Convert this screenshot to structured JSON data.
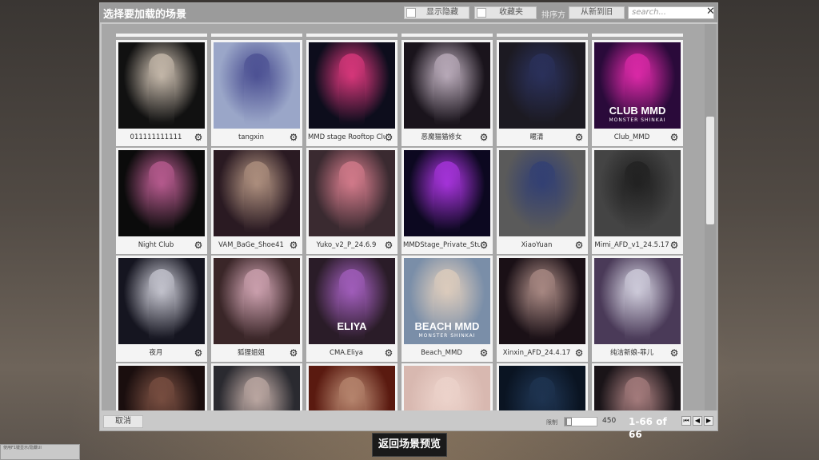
{
  "dialog": {
    "title": "选择要加载的场景",
    "show_hidden_label": "显示隐藏",
    "favorites_label": "收藏夹",
    "sort_label": "排序方",
    "sort_value": "从新到旧",
    "search_placeholder": "search...",
    "close_symbol": "✕"
  },
  "tiles": [
    {
      "label": "011111111111",
      "bg": "#111111",
      "accent": "#e8d9c8"
    },
    {
      "label": "tangxin",
      "bg": "#9aa6c8",
      "accent": "#3c3f88"
    },
    {
      "label": "MMD stage Rooftop Club",
      "bg": "#0d0d1c",
      "accent": "#ff3f8d",
      "overlay": ""
    },
    {
      "label": "恶魔猫猫修女",
      "bg": "#1a141c",
      "accent": "#d8c8d8"
    },
    {
      "label": "暱清",
      "bg": "#1c1a22",
      "accent": "#2d3566"
    },
    {
      "label": "Club_MMD",
      "bg": "#2a0a3a",
      "accent": "#ff2fbd",
      "overlay": "CLUB MMD",
      "overlay_sub": "MONSTER SHINKAI"
    },
    {
      "label": "Night Club",
      "bg": "#0b0b0b",
      "accent": "#d86aa8"
    },
    {
      "label": "VAM_BaGe_Shoe41",
      "bg": "#2a1a22",
      "accent": "#c7a690"
    },
    {
      "label": "Yuko_v2_P_24.6.9",
      "bg": "#3a2a30",
      "accent": "#f08a9c"
    },
    {
      "label": "MMDStage_Private_Studio",
      "bg": "#0c0820",
      "accent": "#c43cff"
    },
    {
      "label": "XiaoYuan",
      "bg": "#5a5a5a",
      "accent": "#2a3a78"
    },
    {
      "label": "Mimi_AFD_v1_24.5.17",
      "bg": "#444444",
      "accent": "#1a1a1a"
    },
    {
      "label": "夜月",
      "bg": "#151520",
      "accent": "#e6e6f0"
    },
    {
      "label": "狐狸姐姐",
      "bg": "#3a2628",
      "accent": "#e8b8c8"
    },
    {
      "label": "CMA.Eliya",
      "bg": "#2a1c28",
      "accent": "#b86ad8",
      "overlay": "ELIYA"
    },
    {
      "label": "Beach_MMD",
      "bg": "#7a8ea8",
      "accent": "#f0d8c0",
      "overlay": "BEACH MMD",
      "overlay_sub": "MONSTER SHINKAI"
    },
    {
      "label": "Xinxin_AFD_24.4.17",
      "bg": "#1a1016",
      "accent": "#c4a098"
    },
    {
      "label": "纯洁新娘-菲儿",
      "bg": "#4a3a58",
      "accent": "#e8e8f4"
    },
    {
      "label": "",
      "bg": "#1a0e0e",
      "accent": "#8a5a4a"
    },
    {
      "label": "",
      "bg": "#2a2a30",
      "accent": "#d8c0b8"
    },
    {
      "label": "",
      "bg": "#5a1a10",
      "accent": "#c89a80"
    },
    {
      "label": "",
      "bg": "#d8b8b0",
      "accent": "#f0d8d0"
    },
    {
      "label": "",
      "bg": "#0a1422",
      "accent": "#223a5a"
    },
    {
      "label": "",
      "bg": "#1a1418",
      "accent": "#c09090"
    }
  ],
  "footer": {
    "cancel_label": "取消",
    "limit_label": "限制",
    "limit_value": "450",
    "limit_fraction": 0.18,
    "count_label": "1-66 of 66",
    "first_symbol": "⏮",
    "prev_symbol": "◀",
    "next_symbol": "▶"
  },
  "back_button_label": "返回场景预览",
  "corner_text": "使用F1键显示/隐藏UI"
}
